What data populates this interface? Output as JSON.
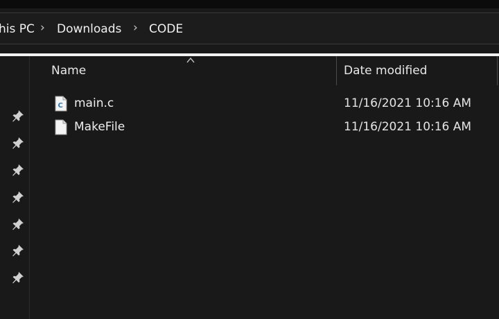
{
  "breadcrumb": {
    "items": [
      "his PC",
      "Downloads",
      "CODE"
    ],
    "separator": "›"
  },
  "nav_pins": [
    "pin-icon",
    "pin-icon",
    "pin-icon",
    "pin-icon",
    "pin-icon",
    "pin-icon",
    "pin-icon"
  ],
  "columns": {
    "name": "Name",
    "date_modified": "Date modified"
  },
  "files": [
    {
      "name": "main.c",
      "date_modified": "11/16/2021 10:16 AM",
      "icon": "c-file-icon"
    },
    {
      "name": "MakeFile",
      "date_modified": "11/16/2021 10:16 AM",
      "icon": "file-icon"
    }
  ],
  "colors": {
    "background": "#191919",
    "accent_c_icon": "#2b7bbd"
  }
}
